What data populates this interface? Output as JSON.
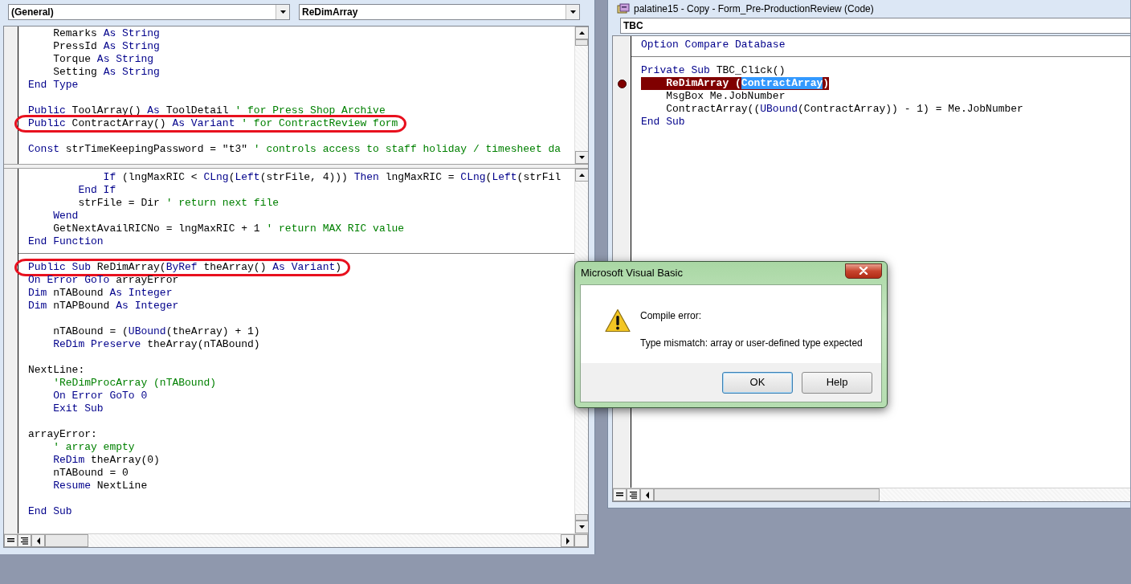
{
  "left_window": {
    "object_dropdown": "(General)",
    "procedure_dropdown": "ReDimArray",
    "upper_pane": {
      "procedures": [
        {
          "blocks": [
            [
              {
                "circled": false,
                "segments": [
                  {
                    "kind": "plain",
                    "text": "    Remarks "
                  },
                  {
                    "kind": "keyword",
                    "text": "As String"
                  }
                ]
              },
              {
                "circled": false,
                "segments": [
                  {
                    "kind": "plain",
                    "text": "    PressId "
                  },
                  {
                    "kind": "keyword",
                    "text": "As String"
                  }
                ]
              },
              {
                "circled": false,
                "segments": [
                  {
                    "kind": "plain",
                    "text": "    Torque "
                  },
                  {
                    "kind": "keyword",
                    "text": "As String"
                  }
                ]
              },
              {
                "circled": false,
                "segments": [
                  {
                    "kind": "plain",
                    "text": "    Setting "
                  },
                  {
                    "kind": "keyword",
                    "text": "As String"
                  }
                ]
              },
              {
                "circled": false,
                "segments": [
                  {
                    "kind": "keyword",
                    "text": "End Type"
                  }
                ]
              }
            ],
            [
              {
                "circled": false,
                "segments": [
                  {
                    "kind": "keyword",
                    "text": "Public"
                  },
                  {
                    "kind": "plain",
                    "text": " ToolArray() "
                  },
                  {
                    "kind": "keyword",
                    "text": "As"
                  },
                  {
                    "kind": "plain",
                    "text": " ToolDetail "
                  },
                  {
                    "kind": "comment",
                    "text": "' for Press Shop Archive"
                  }
                ]
              },
              {
                "circled": true,
                "segments": [
                  {
                    "kind": "keyword",
                    "text": "Public"
                  },
                  {
                    "kind": "plain",
                    "text": " ContractArray() "
                  },
                  {
                    "kind": "keyword",
                    "text": "As Variant"
                  },
                  {
                    "kind": "comment",
                    "text": " ' for ContractReview form"
                  }
                ]
              }
            ],
            [
              {
                "circled": false,
                "segments": [
                  {
                    "kind": "keyword",
                    "text": "Const"
                  },
                  {
                    "kind": "plain",
                    "text": " strTimeKeepingPassword = \"t3\" "
                  },
                  {
                    "kind": "comment",
                    "text": "' controls access to staff holiday / timesheet da"
                  }
                ]
              }
            ]
          ]
        }
      ]
    },
    "lower_pane": {
      "procedures": [
        {
          "blocks": [
            [
              {
                "circled": false,
                "segments": [
                  {
                    "kind": "keyword",
                    "text": "            If"
                  },
                  {
                    "kind": "plain",
                    "text": " (lngMaxRIC < "
                  },
                  {
                    "kind": "keyword",
                    "text": "CLng"
                  },
                  {
                    "kind": "plain",
                    "text": "("
                  },
                  {
                    "kind": "keyword",
                    "text": "Left"
                  },
                  {
                    "kind": "plain",
                    "text": "(strFile, 4))) "
                  },
                  {
                    "kind": "keyword",
                    "text": "Then"
                  },
                  {
                    "kind": "plain",
                    "text": " lngMaxRIC = "
                  },
                  {
                    "kind": "keyword",
                    "text": "CLng"
                  },
                  {
                    "kind": "plain",
                    "text": "("
                  },
                  {
                    "kind": "keyword",
                    "text": "Left"
                  },
                  {
                    "kind": "plain",
                    "text": "(strFil"
                  }
                ]
              },
              {
                "circled": false,
                "segments": [
                  {
                    "kind": "keyword",
                    "text": "        End If"
                  }
                ]
              },
              {
                "circled": false,
                "segments": [
                  {
                    "kind": "plain",
                    "text": "        strFile = Dir "
                  },
                  {
                    "kind": "comment",
                    "text": "' return next file"
                  }
                ]
              },
              {
                "circled": false,
                "segments": [
                  {
                    "kind": "keyword",
                    "text": "    Wend"
                  }
                ]
              },
              {
                "circled": false,
                "segments": [
                  {
                    "kind": "plain",
                    "text": "    GetNextAvailRICNo = lngMaxRIC + 1 "
                  },
                  {
                    "kind": "comment",
                    "text": "' return MAX RIC value"
                  }
                ]
              },
              {
                "circled": false,
                "segments": [
                  {
                    "kind": "keyword",
                    "text": "End Function"
                  }
                ]
              }
            ]
          ]
        },
        {
          "blocks": [
            [
              {
                "circled": true,
                "segments": [
                  {
                    "kind": "keyword",
                    "text": "Public Sub"
                  },
                  {
                    "kind": "plain",
                    "text": " ReDimArray("
                  },
                  {
                    "kind": "keyword",
                    "text": "ByRef"
                  },
                  {
                    "kind": "plain",
                    "text": " theArray() "
                  },
                  {
                    "kind": "keyword",
                    "text": "As Variant"
                  },
                  {
                    "kind": "plain",
                    "text": ")"
                  }
                ]
              },
              {
                "circled": false,
                "segments": [
                  {
                    "kind": "keyword",
                    "text": "On Error GoTo"
                  },
                  {
                    "kind": "plain",
                    "text": " arrayError"
                  }
                ]
              },
              {
                "circled": false,
                "segments": [
                  {
                    "kind": "keyword",
                    "text": "Dim"
                  },
                  {
                    "kind": "plain",
                    "text": " nTABound "
                  },
                  {
                    "kind": "keyword",
                    "text": "As Integer"
                  }
                ]
              },
              {
                "circled": false,
                "segments": [
                  {
                    "kind": "keyword",
                    "text": "Dim"
                  },
                  {
                    "kind": "plain",
                    "text": " nTAPBound "
                  },
                  {
                    "kind": "keyword",
                    "text": "As Integer"
                  }
                ]
              }
            ],
            [
              {
                "circled": false,
                "segments": [
                  {
                    "kind": "plain",
                    "text": "    nTABound = ("
                  },
                  {
                    "kind": "keyword",
                    "text": "UBound"
                  },
                  {
                    "kind": "plain",
                    "text": "(theArray) + 1)"
                  }
                ]
              },
              {
                "circled": false,
                "segments": [
                  {
                    "kind": "keyword",
                    "text": "    ReDim Preserve"
                  },
                  {
                    "kind": "plain",
                    "text": " theArray(nTABound)"
                  }
                ]
              }
            ],
            [
              {
                "circled": false,
                "segments": [
                  {
                    "kind": "plain",
                    "text": "NextLine:"
                  }
                ]
              },
              {
                "circled": false,
                "segments": [
                  {
                    "kind": "comment",
                    "text": "    'ReDimProcArray (nTABound)"
                  }
                ]
              },
              {
                "circled": false,
                "segments": [
                  {
                    "kind": "keyword",
                    "text": "    On Error GoTo 0"
                  }
                ]
              },
              {
                "circled": false,
                "segments": [
                  {
                    "kind": "keyword",
                    "text": "    Exit Sub"
                  }
                ]
              }
            ],
            [
              {
                "circled": false,
                "segments": [
                  {
                    "kind": "plain",
                    "text": "arrayError:"
                  }
                ]
              },
              {
                "circled": false,
                "segments": [
                  {
                    "kind": "comment",
                    "text": "    ' array empty"
                  }
                ]
              },
              {
                "circled": false,
                "segments": [
                  {
                    "kind": "keyword",
                    "text": "    ReDim"
                  },
                  {
                    "kind": "plain",
                    "text": " theArray(0)"
                  }
                ]
              },
              {
                "circled": false,
                "segments": [
                  {
                    "kind": "plain",
                    "text": "    nTABound = 0"
                  }
                ]
              },
              {
                "circled": false,
                "segments": [
                  {
                    "kind": "keyword",
                    "text": "    Resume"
                  },
                  {
                    "kind": "plain",
                    "text": " NextLine"
                  }
                ]
              }
            ],
            [
              {
                "circled": false,
                "segments": [
                  {
                    "kind": "keyword",
                    "text": "End Sub"
                  }
                ]
              }
            ]
          ]
        }
      ]
    }
  },
  "right_window": {
    "title": "palatine15 - Copy - Form_Pre-ProductionReview (Code)",
    "object_dropdown": "TBC",
    "code": {
      "procedures": [
        {
          "blocks": [
            [
              {
                "breakpoint": false,
                "segments": [
                  {
                    "kind": "keyword",
                    "text": "Option Compare Database"
                  }
                ]
              }
            ]
          ]
        },
        {
          "blocks": [
            [
              {
                "breakpoint": false,
                "segments": [
                  {
                    "kind": "keyword",
                    "text": "Private Sub"
                  },
                  {
                    "kind": "plain",
                    "text": " TBC_Click()"
                  }
                ]
              },
              {
                "breakpoint": true,
                "segments": [
                  {
                    "kind": "plain",
                    "text": "    ReDimArray ("
                  },
                  {
                    "kind": "selection",
                    "text": "ContractArray"
                  },
                  {
                    "kind": "plain",
                    "text": ")"
                  }
                ]
              },
              {
                "breakpoint": false,
                "segments": [
                  {
                    "kind": "plain",
                    "text": "    MsgBox Me.JobNumber"
                  }
                ]
              },
              {
                "breakpoint": false,
                "segments": [
                  {
                    "kind": "plain",
                    "text": "    ContractArray(("
                  },
                  {
                    "kind": "keyword",
                    "text": "UBound"
                  },
                  {
                    "kind": "plain",
                    "text": "(ContractArray)) - 1) = Me.JobNumber"
                  }
                ]
              },
              {
                "breakpoint": false,
                "segments": [
                  {
                    "kind": "keyword",
                    "text": "End Sub"
                  }
                ]
              }
            ]
          ]
        }
      ]
    }
  },
  "dialog": {
    "title": "Microsoft Visual Basic",
    "heading": "Compile error:",
    "message": "Type mismatch: array or user-defined type expected",
    "buttons": [
      {
        "label": "OK",
        "selected": true
      },
      {
        "label": "Help",
        "selected": false
      }
    ]
  }
}
